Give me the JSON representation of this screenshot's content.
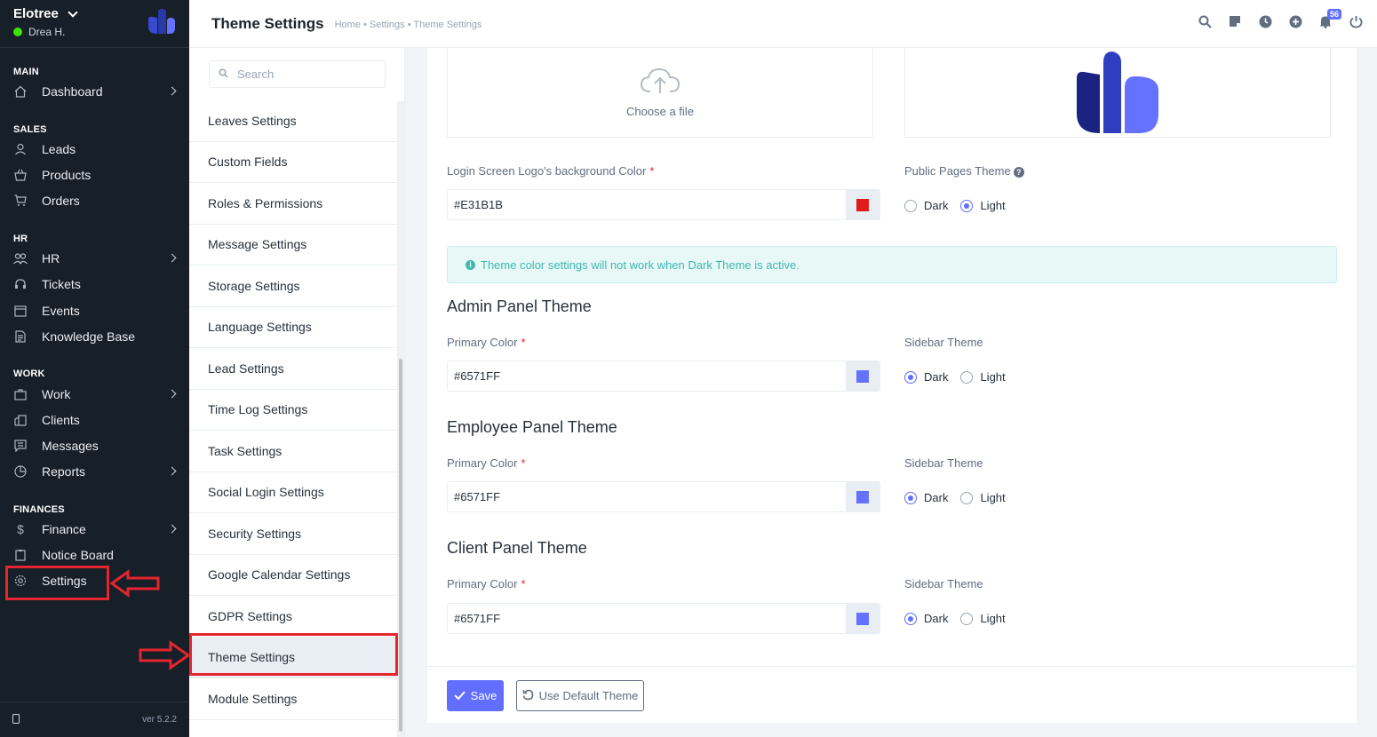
{
  "sidebar": {
    "company": "Elotree",
    "user": "Drea H.",
    "sections": {
      "main": "MAIN",
      "sales": "SALES",
      "hr": "HR",
      "work": "WORK",
      "finances": "FINANCES"
    },
    "items": {
      "dashboard": "Dashboard",
      "leads": "Leads",
      "products": "Products",
      "orders": "Orders",
      "hr": "HR",
      "tickets": "Tickets",
      "events": "Events",
      "knowledge_base": "Knowledge Base",
      "work": "Work",
      "clients": "Clients",
      "messages": "Messages",
      "reports": "Reports",
      "finance": "Finance",
      "notice_board": "Notice Board",
      "settings": "Settings"
    },
    "version": "ver 5.2.2"
  },
  "header": {
    "title": "Theme Settings",
    "breadcrumb": "Home • Settings • Theme Settings",
    "notification_count": "56"
  },
  "settings_menu": {
    "search_placeholder": "Search",
    "items": [
      "Leaves Settings",
      "Custom Fields",
      "Roles & Permissions",
      "Message Settings",
      "Storage Settings",
      "Language Settings",
      "Lead Settings",
      "Time Log Settings",
      "Task Settings",
      "Social Login Settings",
      "Security Settings",
      "Google Calendar Settings",
      "GDPR Settings",
      "Theme Settings",
      "Module Settings"
    ],
    "active": "Theme Settings"
  },
  "content": {
    "upload_label": "Choose a file",
    "login_bg_label": "Login Screen Logo's background Color",
    "login_bg_value": "#E31B1B",
    "public_theme_label": "Public Pages Theme",
    "dark": "Dark",
    "light": "Light",
    "alert": "Theme color settings will not work when Dark Theme is active.",
    "admin_title": "Admin Panel Theme",
    "employee_title": "Employee Panel Theme",
    "client_title": "Client Panel Theme",
    "primary_color_label": "Primary Color",
    "sidebar_theme_label": "Sidebar Theme",
    "admin_primary": "#6571FF",
    "employee_primary": "#6571FF",
    "client_primary": "#6571FF",
    "save": "Save",
    "use_default": "Use Default Theme"
  },
  "colors": {
    "accent": "#616eff",
    "login_bg": "#E31B1B",
    "primary": "#6571FF",
    "sidebar_bg": "#171f29",
    "highlight": "#e4262e"
  }
}
